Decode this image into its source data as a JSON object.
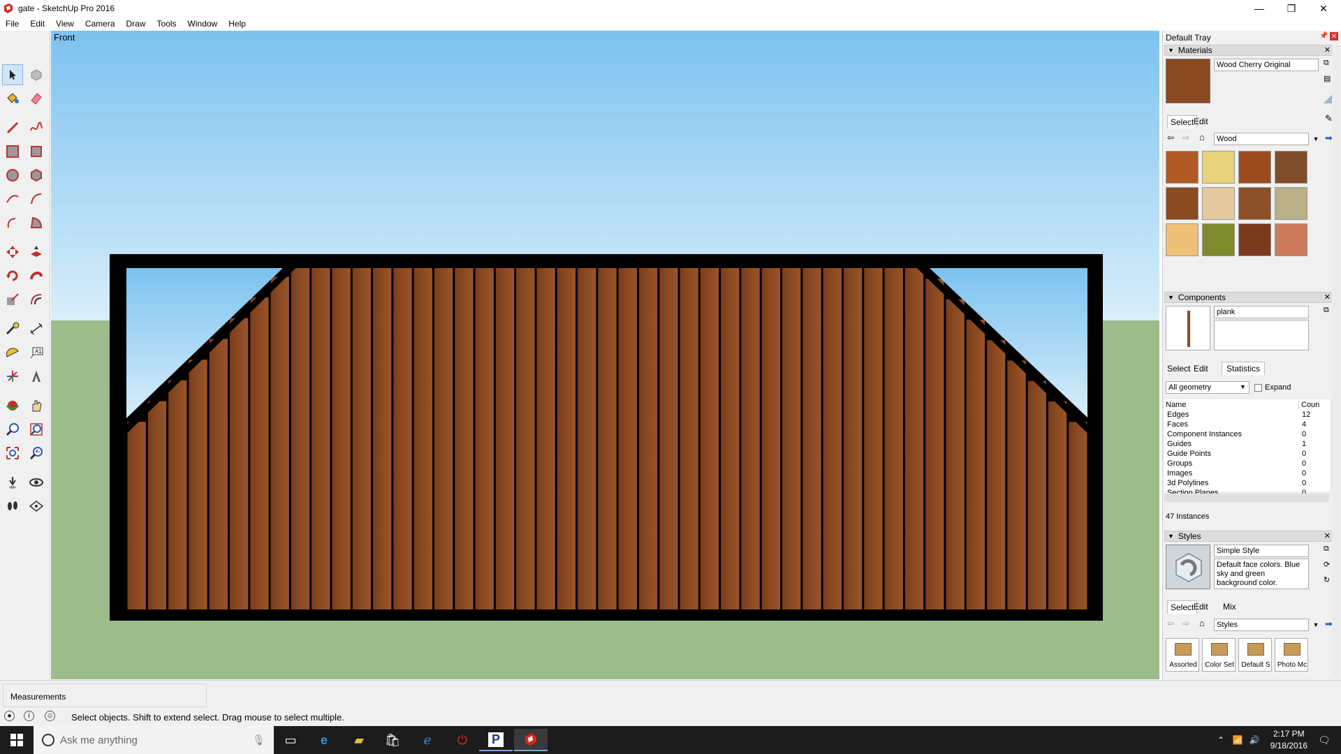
{
  "window": {
    "title": "gate - SketchUp Pro 2016",
    "controls": [
      "—",
      "❐",
      "✕"
    ]
  },
  "menu": [
    "File",
    "Edit",
    "View",
    "Camera",
    "Draw",
    "Tools",
    "Window",
    "Help"
  ],
  "viewport": {
    "label": "Front",
    "colors": {
      "sky_top": "#7cc2f0",
      "sky_bottom": "#d8eefa",
      "ground": "#9cbc8c",
      "frame": "#000000",
      "plank": "#8b4a22"
    }
  },
  "tray": {
    "title": "Default Tray",
    "materials": {
      "header": "Materials",
      "current": "Wood Cherry Original",
      "tabs": [
        "Select",
        "Edit"
      ],
      "library": "Wood",
      "swatches": [
        "#b25a26",
        "#e8d27a",
        "#9c4a20",
        "#7e4e2c",
        "#8a4a22",
        "#e4c8a0",
        "#8e5028",
        "#b8b088",
        "#f0c078",
        "#7e8a2c",
        "#7c3a1c",
        "#cc7a5a"
      ]
    },
    "components": {
      "header": "Components",
      "name": "plank",
      "tabs": [
        "Select",
        "Edit",
        "Statistics"
      ],
      "filter": "All geometry",
      "expand_label": "Expand",
      "col_name": "Name",
      "col_count": "Coun",
      "stats": [
        {
          "name": "Edges",
          "count": "12"
        },
        {
          "name": "Faces",
          "count": "4"
        },
        {
          "name": "Component Instances",
          "count": "0"
        },
        {
          "name": "Guides",
          "count": "1"
        },
        {
          "name": "Guide Points",
          "count": "0"
        },
        {
          "name": "Groups",
          "count": "0"
        },
        {
          "name": "Images",
          "count": "0"
        },
        {
          "name": "3d Polylines",
          "count": "0"
        },
        {
          "name": "Section Planes",
          "count": "0"
        }
      ],
      "instances": "47 Instances"
    },
    "styles": {
      "header": "Styles",
      "name": "Simple Style",
      "description": "Default face colors. Blue sky and green background color.",
      "tabs": [
        "Select",
        "Edit",
        "Mix"
      ],
      "library": "Styles",
      "items": [
        "Assorted",
        "Color Set",
        "Default S",
        "Photo Mc"
      ]
    }
  },
  "status": {
    "measurements_label": "Measurements",
    "hint": "Select objects. Shift to extend select. Drag mouse to select multiple."
  },
  "taskbar": {
    "search_placeholder": "Ask me anything",
    "time": "2:17 PM",
    "date": "9/18/2016"
  }
}
